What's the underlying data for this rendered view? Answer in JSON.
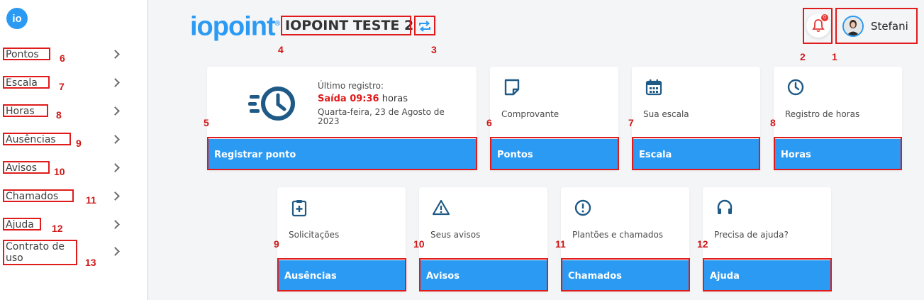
{
  "sidebar": {
    "logo_text": "io",
    "items": [
      {
        "label": "Pontos",
        "anno": "6"
      },
      {
        "label": "Escala",
        "anno": "7"
      },
      {
        "label": "Horas",
        "anno": "8"
      },
      {
        "label": "Ausências",
        "anno": "9"
      },
      {
        "label": "Avisos",
        "anno": "10"
      },
      {
        "label": "Chamados",
        "anno": "11"
      },
      {
        "label": "Ajuda",
        "anno": "12"
      },
      {
        "label": "Contrato de uso",
        "anno": "13"
      }
    ]
  },
  "header": {
    "brand": "iopoint",
    "brand_mark": "®",
    "company": "IOPOINT TESTE 2",
    "company_anno": "4",
    "refresh_anno": "3",
    "notif_count": "0",
    "notif_anno": "2",
    "user_name": "Stefani",
    "user_anno": "1"
  },
  "cards_top": {
    "register": {
      "last_label": "Último registro:",
      "last_type": "Saída 09:36",
      "last_unit": " horas",
      "last_date": "Quarta-feira, 23 de Agosto de 2023",
      "button": "Registrar ponto",
      "anno": "5"
    },
    "pontos": {
      "text": "Comprovante",
      "button": "Pontos",
      "anno": "6",
      "icon": "note-icon"
    },
    "escala": {
      "text": "Sua escala",
      "button": "Escala",
      "anno": "7",
      "icon": "calendar-icon"
    },
    "horas": {
      "text": "Registro de horas",
      "button": "Horas",
      "anno": "8",
      "icon": "clock-icon"
    }
  },
  "cards_bottom": {
    "ausencias": {
      "text": "Solicitações",
      "button": "Ausências",
      "anno": "9",
      "icon": "clipboard-plus-icon"
    },
    "avisos": {
      "text": "Seus avisos",
      "button": "Avisos",
      "anno": "10",
      "icon": "warning-icon"
    },
    "chamados": {
      "text": "Plantões e chamados",
      "button": "Chamados",
      "anno": "11",
      "icon": "alert-circle-icon"
    },
    "ajuda": {
      "text": "Precisa de ajuda?",
      "button": "Ajuda",
      "anno": "12",
      "icon": "headset-icon"
    }
  },
  "colors": {
    "accent": "#2b9af3",
    "annotation": "#e01b1b"
  }
}
